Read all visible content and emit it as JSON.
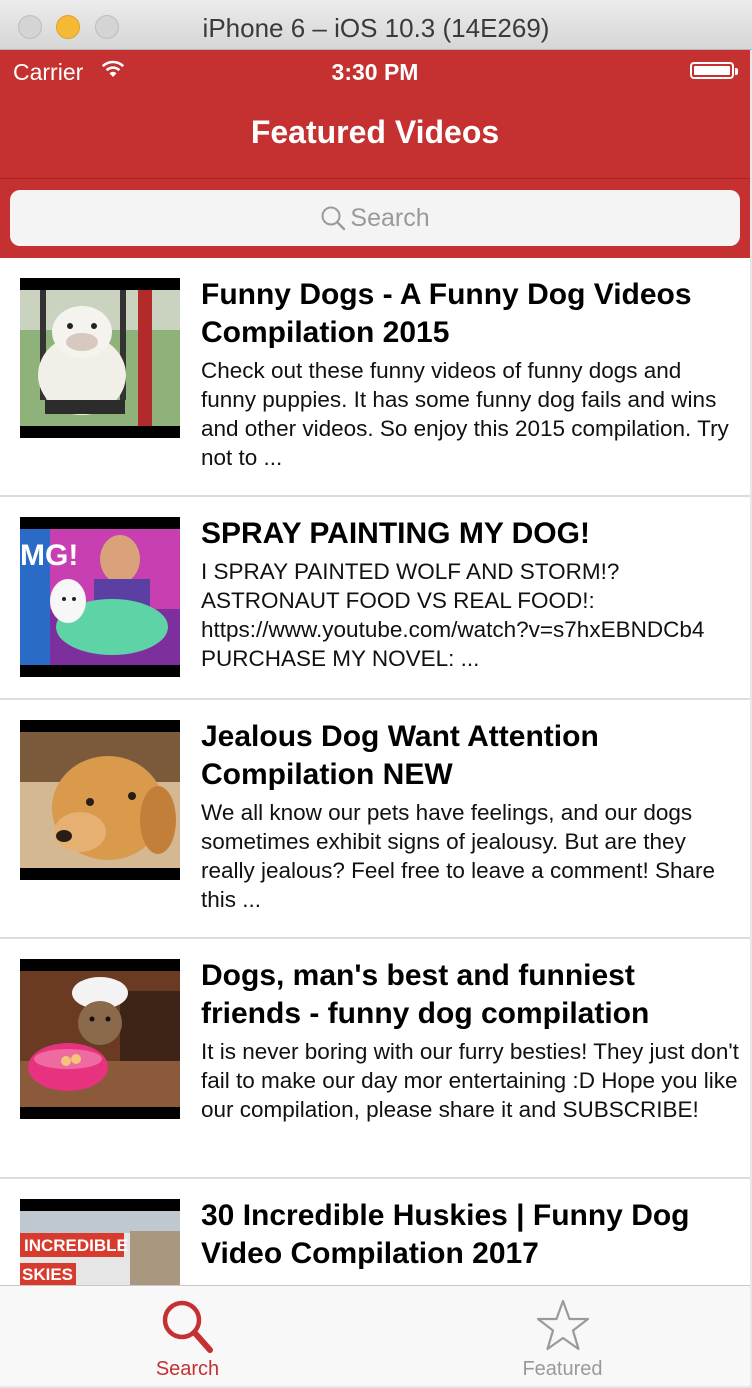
{
  "window": {
    "title": "iPhone 6 – iOS 10.3 (14E269)"
  },
  "status_bar": {
    "carrier": "Carrier",
    "time": "3:30 PM"
  },
  "nav": {
    "title": "Featured Videos"
  },
  "search": {
    "placeholder": "Search"
  },
  "videos": [
    {
      "title": "Funny Dogs - A Funny Dog Videos Compilation 2015",
      "description": "Check out these funny videos of funny dogs and funny puppies. It has some funny dog fails and wins and other videos. So enjoy this 2015 compilation. Try not to ..."
    },
    {
      "title": "SPRAY PAINTING MY DOG!",
      "description": "I SPRAY PAINTED WOLF AND STORM!? ASTRONAUT FOOD VS REAL FOOD!: https://www.youtube.com/watch?v=s7hxEBNDCb4 PURCHASE MY NOVEL: ...",
      "thumb_text": "MG!"
    },
    {
      "title": "Jealous Dog Want Attention Compilation NEW",
      "description": "We all know our pets have feelings, and our dogs sometimes exhibit signs of jealousy. But are they really jealous? Feel free to leave a comment! Share this ..."
    },
    {
      "title": "Dogs, man's best and funniest friends - funny dog compilation",
      "description": "It is never boring with our furry besties! They just don't fail to make our day mor entertaining :D Hope you like our compilation, please share it and SUBSCRIBE!"
    },
    {
      "title": "30 Incredible Huskies | Funny Dog Video Compilation 2017",
      "description": "",
      "thumb_text_1": "INCREDIBLE",
      "thumb_text_2": "SKIES"
    }
  ],
  "tabs": [
    {
      "label": "Search",
      "icon": "search-icon",
      "selected": true
    },
    {
      "label": "Featured",
      "icon": "star-icon",
      "selected": false
    }
  ],
  "colors": {
    "accent": "#c53030",
    "inactive": "#9a9a9a"
  }
}
